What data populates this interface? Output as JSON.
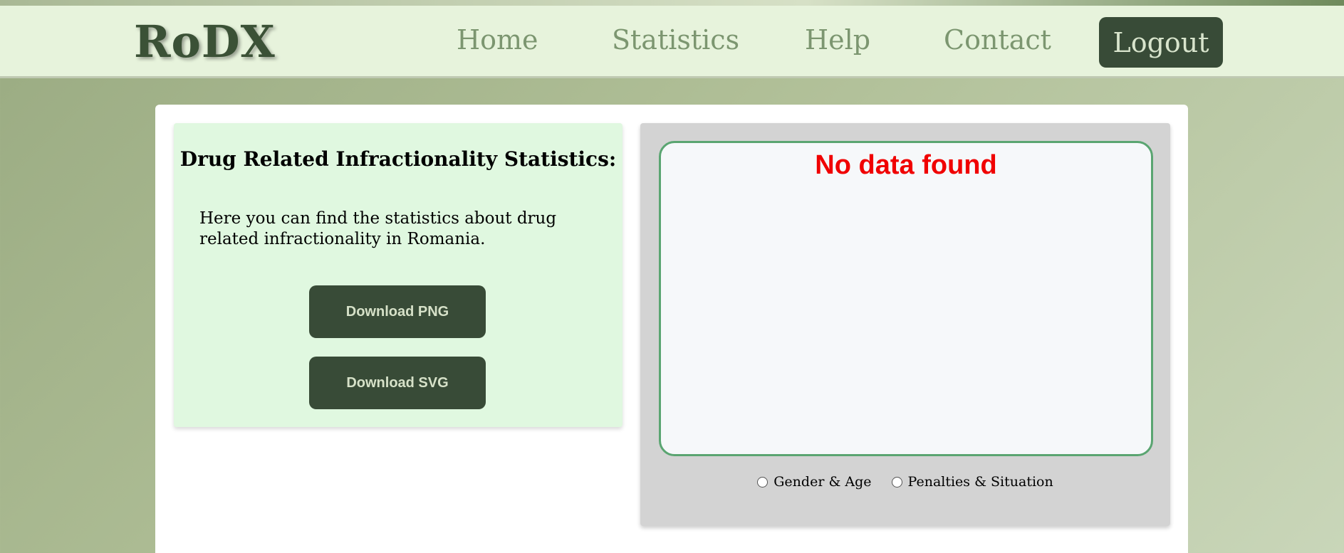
{
  "header": {
    "logo": "RoDX",
    "nav": {
      "home": "Home",
      "statistics": "Statistics",
      "help": "Help",
      "contact": "Contact"
    },
    "logout_label": "Logout"
  },
  "info_panel": {
    "title": "Drug Related Infractionality Statistics:",
    "description": "Here you can find the statistics about drug related infractionality in Romania.",
    "download_png_label": "Download PNG",
    "download_svg_label": "Download SVG"
  },
  "chart_panel": {
    "empty_message": "No data found",
    "options": [
      {
        "label": "Gender & Age",
        "selected": false
      },
      {
        "label": "Penalties & Situation",
        "selected": false
      }
    ]
  },
  "colors": {
    "brand_dark": "#384b37",
    "nav_link": "#7c9670",
    "panel_green": "#e0f8e0",
    "error_red": "#f00000",
    "chart_border": "#5aa571"
  }
}
